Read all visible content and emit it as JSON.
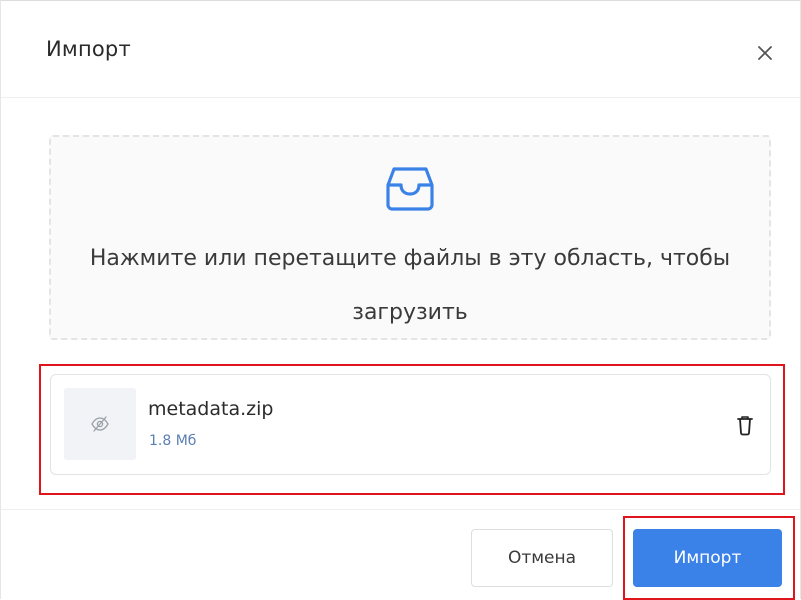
{
  "dialog": {
    "title": "Импорт",
    "close_icon": "close-icon"
  },
  "dropzone": {
    "icon": "inbox-icon",
    "text": "Нажмите или перетащите файлы в эту область, чтобы загрузить"
  },
  "file": {
    "thumbnail_icon": "eye-off-icon",
    "name": "metadata.zip",
    "size": "1.8 Мб",
    "delete_icon": "trash-icon"
  },
  "footer": {
    "cancel_label": "Отмена",
    "import_label": "Импорт"
  },
  "colors": {
    "accent": "#3b82e8",
    "highlight": "#e0141b",
    "file_size": "#5b7fb4"
  }
}
